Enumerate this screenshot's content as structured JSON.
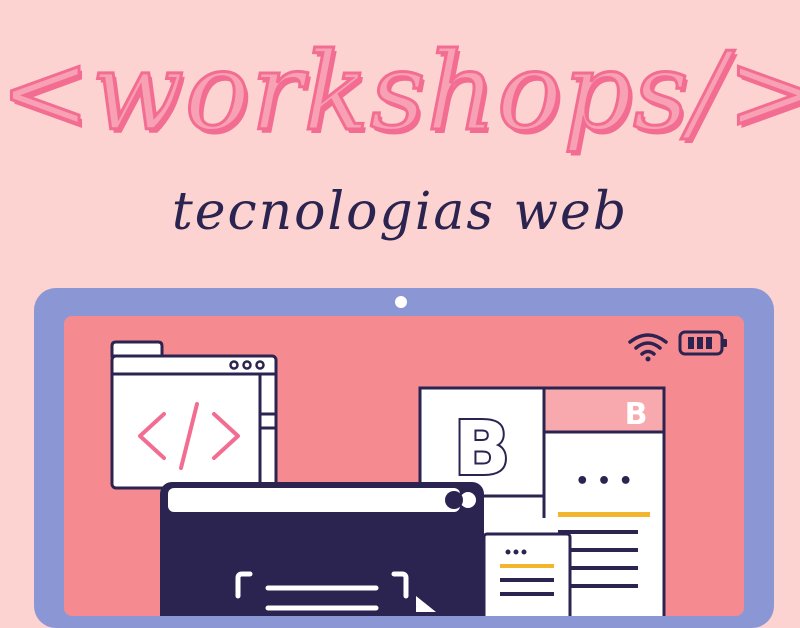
{
  "header": {
    "title": "<workshops/>",
    "subtitle": "tecnologias web"
  },
  "status_bar": {
    "icons": [
      "wifi-icon",
      "battery-icon"
    ]
  },
  "windows": {
    "code_window": {
      "icon": "code-brackets-icon",
      "glyph": "</>"
    },
    "bootstrap_window": {
      "logo": "B",
      "badge": "B",
      "dots": "• • •"
    },
    "dark_window": {
      "icon": "scan-frame-icon"
    }
  },
  "colors": {
    "background": "#fcd3d0",
    "title_pink": "#f36d92",
    "subtitle_navy": "#2b2350",
    "tablet_frame": "#8b96d4",
    "screen": "#f58b90",
    "accent_yellow": "#f4b52e",
    "dark_window": "#2b2350"
  }
}
